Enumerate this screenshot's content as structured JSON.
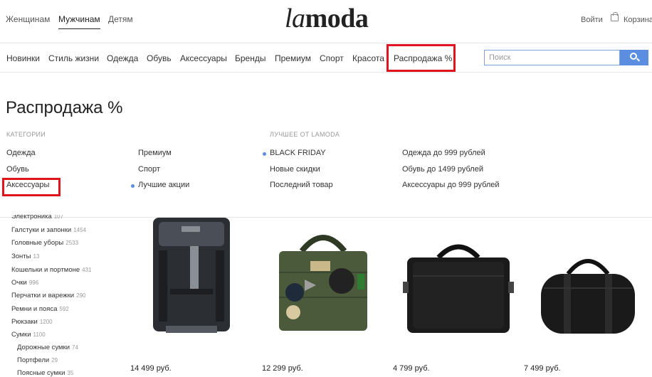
{
  "header": {
    "gender_tabs": [
      "Женщинам",
      "Мужчинам",
      "Детям"
    ],
    "logo_la": "la",
    "logo_moda": "moda",
    "login": "Войти",
    "cart": "Корзина"
  },
  "nav": {
    "items": [
      "Новинки",
      "Стиль жизни",
      "Одежда",
      "Обувь",
      "Аксессуары",
      "Бренды",
      "Премиум",
      "Спорт",
      "Красота",
      "Распродажа %"
    ],
    "search_placeholder": "Поиск"
  },
  "menu": {
    "title": "Распродажа %",
    "categories_head": "Категории",
    "best_head": "Лучшее от Lamoda",
    "col1": [
      "Одежда",
      "Обувь",
      "Аксессуары"
    ],
    "col2": [
      "Премиум",
      "Спорт",
      "Лучшие акции"
    ],
    "col3": [
      "BLACK FRIDAY",
      "Новые скидки",
      "Последний товар"
    ],
    "col4": [
      "Одежда до 999 рублей",
      "Обувь до 1499 рублей",
      "Аксессуары до 999 рублей"
    ]
  },
  "sidebar": {
    "items": [
      {
        "label": "Электроника",
        "count": "107"
      },
      {
        "label": "Галстуки и запонки",
        "count": "1454"
      },
      {
        "label": "Головные уборы",
        "count": "2533"
      },
      {
        "label": "Зонты",
        "count": "13"
      },
      {
        "label": "Кошельки и портмоне",
        "count": "431"
      },
      {
        "label": "Очки",
        "count": "996"
      },
      {
        "label": "Перчатки и варежки",
        "count": "290"
      },
      {
        "label": "Ремни и пояса",
        "count": "592"
      },
      {
        "label": "Рюкзаки",
        "count": "1200"
      },
      {
        "label": "Сумки",
        "count": "1100"
      },
      {
        "label": "Дорожные сумки",
        "count": "74"
      },
      {
        "label": "Портфели",
        "count": "29"
      },
      {
        "label": "Поясные сумки",
        "count": "35"
      }
    ]
  },
  "products": [
    {
      "price": "14 499 руб.",
      "icon": "wheeled-duffel-bag-icon"
    },
    {
      "price": "12 299 руб.",
      "icon": "patched-tote-bag-icon"
    },
    {
      "price": "4 799 руб.",
      "icon": "leather-briefcase-icon"
    },
    {
      "price": "7 499 руб.",
      "icon": "black-duffel-bag-icon"
    }
  ],
  "colors": {
    "accent": "#5b8ee0",
    "highlight": "#e0141e"
  }
}
